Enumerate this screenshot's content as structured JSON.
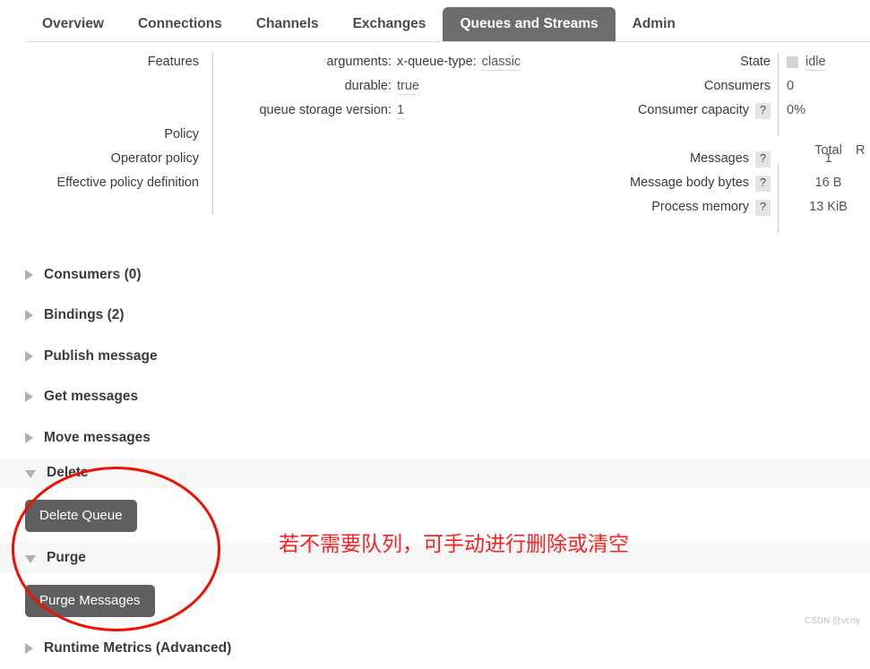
{
  "nav": {
    "tabs": [
      {
        "label": "Overview",
        "active": false
      },
      {
        "label": "Connections",
        "active": false
      },
      {
        "label": "Channels",
        "active": false
      },
      {
        "label": "Exchanges",
        "active": false
      },
      {
        "label": "Queues and Streams",
        "active": true
      },
      {
        "label": "Admin",
        "active": false
      }
    ]
  },
  "details": {
    "left_labels": [
      "Features",
      "",
      "",
      "Policy",
      "Operator policy",
      "Effective policy definition"
    ],
    "features": [
      {
        "key": "arguments:",
        "subkey": "x-queue-type:",
        "value": "classic"
      },
      {
        "key": "durable:",
        "subkey": "",
        "value": "true"
      },
      {
        "key": "queue storage version:",
        "subkey": "",
        "value": "1"
      }
    ],
    "right_labels": [
      {
        "label": "State",
        "help": false
      },
      {
        "label": "Consumers",
        "help": false
      },
      {
        "label": "Consumer capacity",
        "help": true
      }
    ],
    "state": {
      "indicator_color": "#d3d3d3",
      "text": "idle"
    },
    "consumers": "0",
    "consumer_capacity": "0%",
    "metrics_header": {
      "total": "Total",
      "ready_truncated": "R"
    },
    "metrics": [
      {
        "label": "Messages",
        "help": "?",
        "total": "1"
      },
      {
        "label": "Message body bytes",
        "help": "?",
        "total": "16 B"
      },
      {
        "label": "Process memory",
        "help": "?",
        "total": "13 KiB"
      }
    ],
    "help_glyph": "?"
  },
  "sections": [
    {
      "title": "Consumers (0)",
      "expanded": false,
      "banded": false
    },
    {
      "title": "Bindings (2)",
      "expanded": false,
      "banded": false
    },
    {
      "title": "Publish message",
      "expanded": false,
      "banded": false
    },
    {
      "title": "Get messages",
      "expanded": false,
      "banded": false
    },
    {
      "title": "Move messages",
      "expanded": false,
      "banded": false
    }
  ],
  "delete_section": {
    "title": "Delete",
    "expanded": true,
    "button_label": "Delete Queue"
  },
  "purge_section": {
    "title": "Purge",
    "expanded": true,
    "button_label": "Purge Messages"
  },
  "bottom_section": {
    "title": "Runtime Metrics (Advanced)"
  },
  "annotation": {
    "text": "若不需要队列，可手动进行删除或清空",
    "color": "#fb2020"
  },
  "watermark": {
    "text": "CSDN @vcoy"
  }
}
